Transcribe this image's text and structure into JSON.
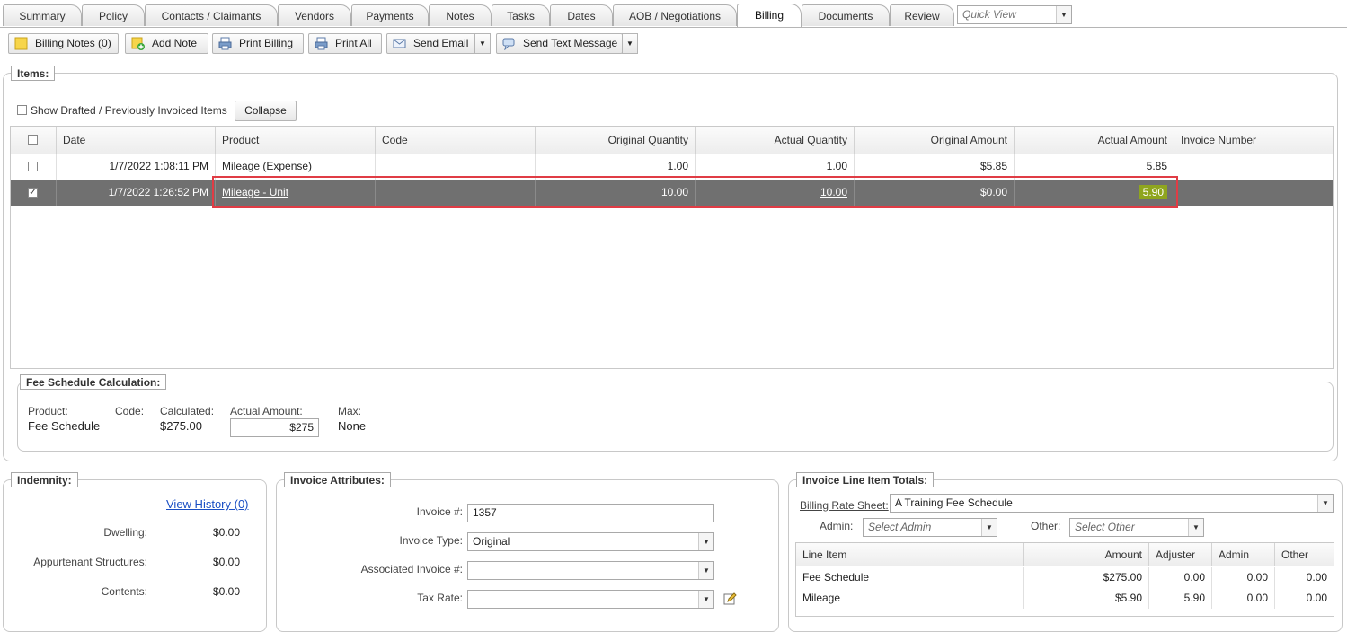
{
  "tabs": [
    "Summary",
    "Policy",
    "Contacts / Claimants",
    "Vendors",
    "Payments",
    "Notes",
    "Tasks",
    "Dates",
    "AOB / Negotiations",
    "Billing",
    "Documents",
    "Review"
  ],
  "active_tab": "Billing",
  "quick_view": {
    "placeholder": "Quick View"
  },
  "toolbar": {
    "billing_notes": "Billing Notes (0)",
    "add_note": "Add Note",
    "print_billing": "Print Billing",
    "print_all": "Print All",
    "send_email": "Send Email",
    "send_text": "Send Text Message"
  },
  "items": {
    "legend": "Items:",
    "show_drafted_label": "Show Drafted / Previously Invoiced Items",
    "collapse_label": "Collapse",
    "columns": [
      "Date",
      "Product",
      "Code",
      "Original Quantity",
      "Actual Quantity",
      "Original Amount",
      "Actual Amount",
      "Invoice Number"
    ],
    "rows": [
      {
        "checked": false,
        "date": "1/7/2022 1:08:11 PM",
        "product": "Mileage (Expense)",
        "code": "",
        "orig_qty": "1.00",
        "actual_qty": "1.00",
        "orig_amount": "$5.85",
        "actual_amount": "5.85",
        "invoice_number": ""
      },
      {
        "checked": true,
        "date": "1/7/2022 1:26:52 PM",
        "product": "Mileage - Unit",
        "code": "",
        "orig_qty": "10.00",
        "actual_qty": "10.00",
        "orig_amount": "$0.00",
        "actual_amount": "5.90",
        "invoice_number": ""
      }
    ]
  },
  "fee_schedule": {
    "legend": "Fee Schedule Calculation:",
    "product_label": "Product:",
    "product_value": "Fee Schedule",
    "code_label": "Code:",
    "calculated_label": "Calculated:",
    "calculated_value": "$275.00",
    "actual_label": "Actual Amount:",
    "actual_value": "$275",
    "max_label": "Max:",
    "max_value": "None"
  },
  "indemnity": {
    "legend": "Indemnity:",
    "view_history": "View History (0)",
    "rows": [
      {
        "label": "Dwelling:",
        "value": "$0.00"
      },
      {
        "label": "Appurtenant Structures:",
        "value": "$0.00"
      },
      {
        "label": "Contents:",
        "value": "$0.00"
      }
    ]
  },
  "invoice_attributes": {
    "legend": "Invoice Attributes:",
    "invoice_num_label": "Invoice #:",
    "invoice_num_value": "1357",
    "invoice_type_label": "Invoice Type:",
    "invoice_type_value": "Original",
    "associated_label": "Associated Invoice #:",
    "associated_value": "",
    "tax_rate_label": "Tax Rate:",
    "tax_rate_value": ""
  },
  "totals": {
    "legend": "Invoice Line Item Totals:",
    "rate_sheet_label": "Billing Rate Sheet:",
    "rate_sheet_value": "A Training Fee Schedule",
    "admin_label": "Admin:",
    "admin_placeholder": "Select Admin",
    "other_label": "Other:",
    "other_placeholder": "Select Other",
    "columns": [
      "Line Item",
      "Amount",
      "Adjuster",
      "Admin",
      "Other"
    ],
    "rows": [
      {
        "item": "Fee Schedule",
        "amount": "$275.00",
        "adjuster": "0.00",
        "admin": "0.00",
        "other": "0.00"
      },
      {
        "item": "Mileage",
        "amount": "$5.90",
        "adjuster": "5.90",
        "admin": "0.00",
        "other": "0.00"
      }
    ]
  },
  "colors": {
    "selected_row": "#707070",
    "highlight": "#8fa51e",
    "annotation_box": "#e03c45"
  }
}
